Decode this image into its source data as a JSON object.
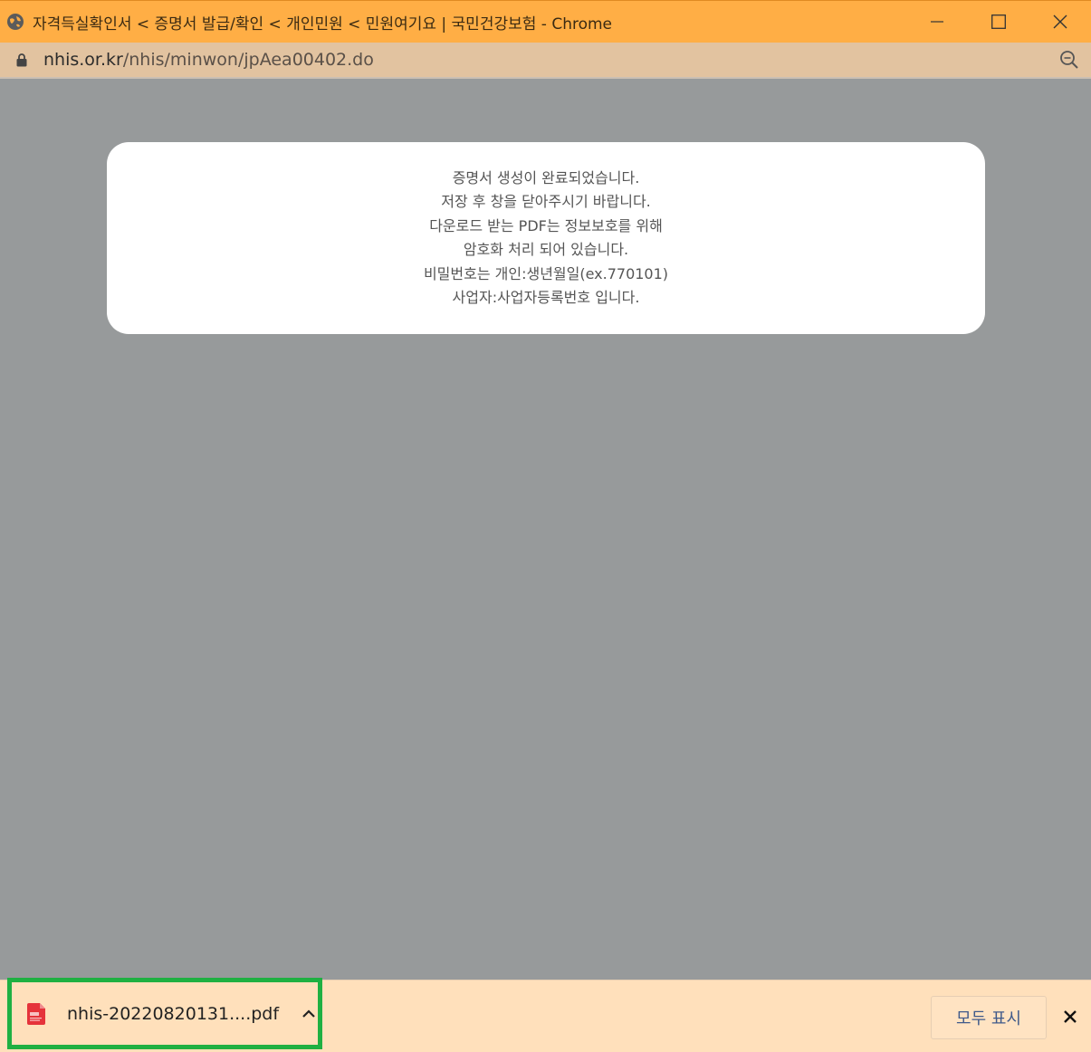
{
  "window": {
    "title": "자격득실확인서 < 증명서 발급/확인 < 개인민원 < 민원여기요 | 국민건강보험 - Chrome",
    "favicon": "globe-icon",
    "controls": [
      "minimize-icon",
      "maximize-icon",
      "close-icon"
    ],
    "title_bar_color": "#ffae45"
  },
  "address_bar": {
    "host": "nhis.or.kr",
    "path": "/nhis/minwon/jpAea00402.do",
    "lock_icon": "lock-icon",
    "zoom_icon": "zoom-icon"
  },
  "dialog": {
    "lines": [
      "증명서 생성이 완료되었습니다.",
      "저장 후 창을 닫아주시기 바랍니다.",
      "다운로드 받는 PDF는 정보보호를 위해",
      "암호화 처리 되어 있습니다.",
      "비밀번호는 개인:생년월일(ex.770101)",
      "사업자:사업자등록번호 입니다."
    ]
  },
  "download_shelf": {
    "item": {
      "filename": "nhis-20220820131....pdf",
      "icon": "pdf-file-icon",
      "menu_icon": "chevron-up-icon",
      "highlight_color": "#1fb042"
    },
    "show_all_label": "모두 표시",
    "close_icon": "close-icon"
  }
}
